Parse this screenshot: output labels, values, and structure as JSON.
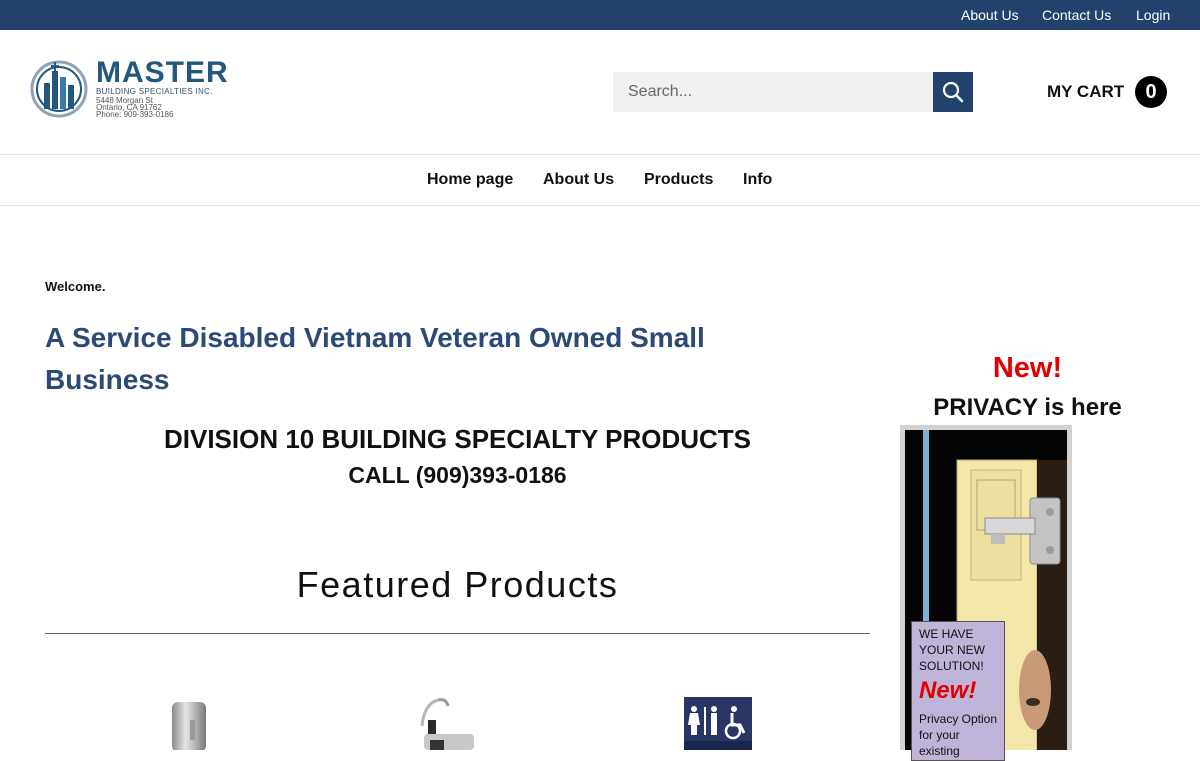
{
  "topbar": {
    "links": [
      "About Us",
      "Contact Us",
      "Login"
    ]
  },
  "logo": {
    "name": "MASTER",
    "subtitle": "BUILDING SPECIALTIES INC.",
    "address_line1": "5448 Morgan St",
    "address_line2": "Ontario, CA  91762",
    "phone": "Phone: 909-393-0186"
  },
  "search": {
    "placeholder": "Search...",
    "button_icon": "search-icon"
  },
  "cart": {
    "label": "MY CART",
    "count": "0"
  },
  "nav": {
    "items": [
      "Home page",
      "About Us",
      "Products",
      "Info"
    ]
  },
  "main": {
    "welcome": "Welcome.",
    "headline": "A Service Disabled Vietnam Veteran Owned Small Business",
    "division": "DIVISION 10 BUILDING SPECIALTY PRODUCTS",
    "call": "CALL (909)393-0186",
    "featured_title": "Featured Products"
  },
  "sidebar": {
    "new": "New!",
    "privacy": "PRIVACY is here",
    "ad": {
      "line1": "WE HAVE",
      "line2": "YOUR NEW",
      "line3": "SOLUTION!",
      "new": "New!",
      "line4": "Privacy Option",
      "line5": "for your",
      "line6": "existing"
    }
  },
  "colors": {
    "brand_navy": "#22416c",
    "headline_blue": "#2b4a76",
    "accent_red": "#e00000"
  }
}
